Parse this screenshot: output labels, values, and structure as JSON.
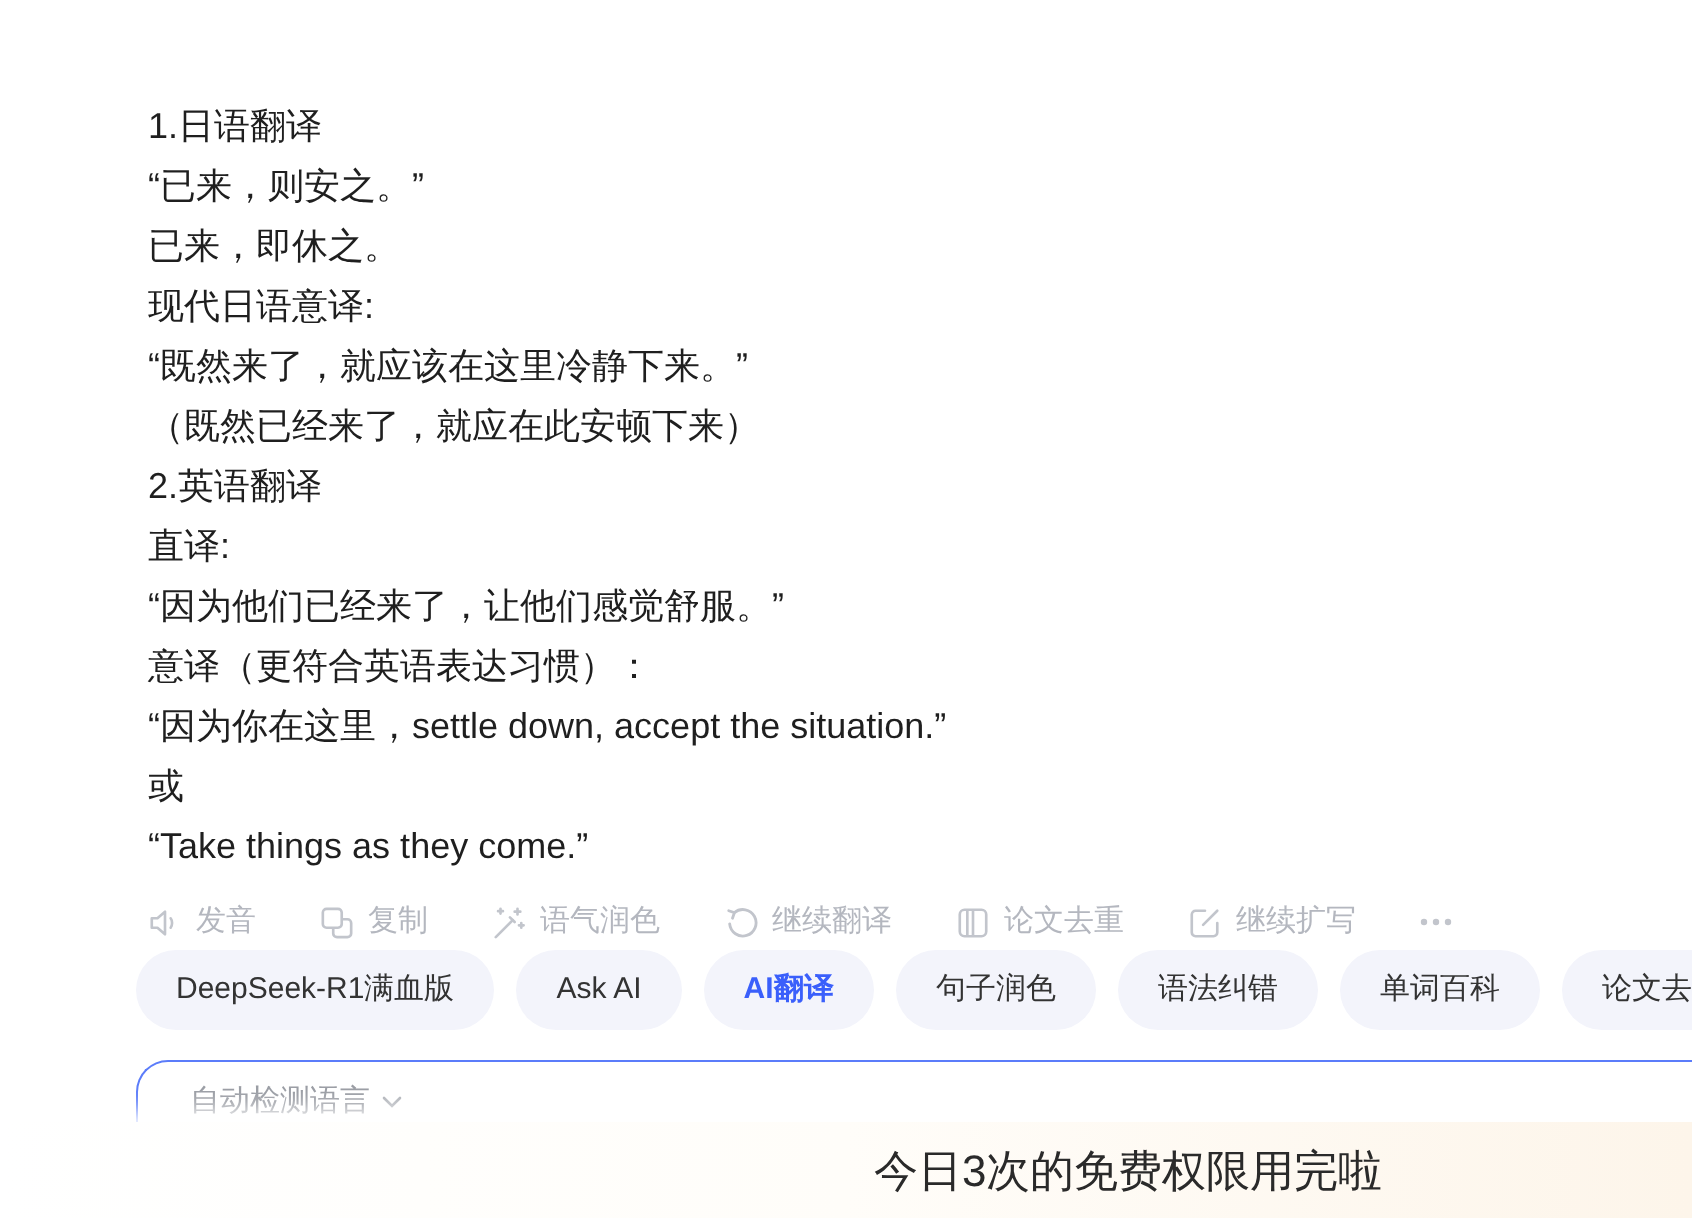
{
  "answer": {
    "lines": [
      "1.日语翻译",
      "“已来，则安之。”",
      "已来，即休之。",
      "现代日语意译:",
      "“既然来了，就应该在这里冷静下来。”",
      "（既然已经来了，就应在此安顿下来）",
      "2.英语翻译",
      "直译:",
      "“因为他们已经来了，让他们感觉舒服。”",
      "意译（更符合英语表达习惯）：",
      "“因为你在这里，settle down, accept the situation.”",
      "或",
      "“Take things as they come.”"
    ]
  },
  "actions": [
    {
      "label": "发音"
    },
    {
      "label": "复制"
    },
    {
      "label": "语气润色"
    },
    {
      "label": "继续翻译"
    },
    {
      "label": "论文去重"
    },
    {
      "label": "继续扩写"
    }
  ],
  "chips": [
    {
      "label": "DeepSeek-R1满血版",
      "selected": false
    },
    {
      "label": "Ask AI",
      "selected": false
    },
    {
      "label": "AI翻译",
      "selected": true
    },
    {
      "label": "句子润色",
      "selected": false
    },
    {
      "label": "语法纠错",
      "selected": false
    },
    {
      "label": "单词百科",
      "selected": false
    },
    {
      "label": "论文去",
      "selected": false
    }
  ],
  "input": {
    "language_selector": "自动检测语言"
  },
  "notice": {
    "text": "今日3次的免费权限用完啦"
  }
}
